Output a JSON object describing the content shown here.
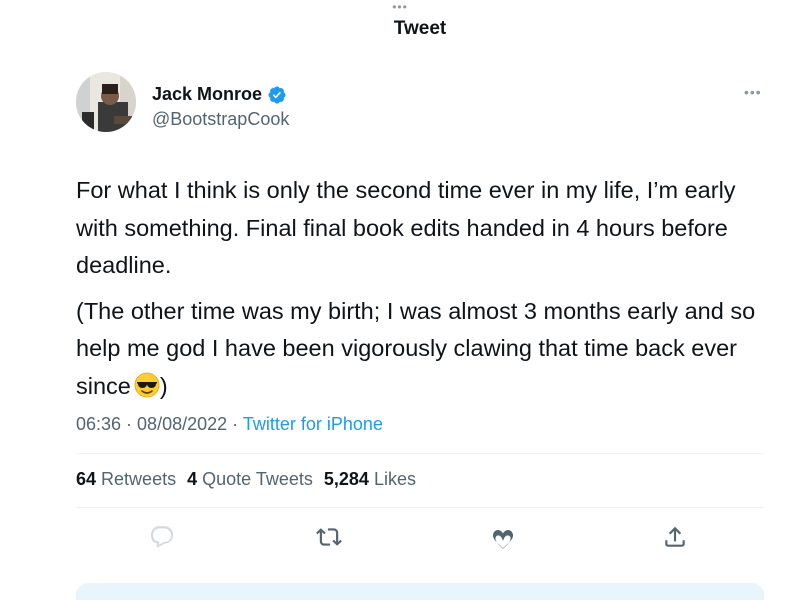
{
  "header": {
    "title": "Tweet",
    "dots": "•••"
  },
  "author": {
    "display_name": "Jack Monroe",
    "handle": "@BootstrapCook",
    "verified": true
  },
  "tweet": {
    "paragraphs": [
      "For what I think is only the second time ever in my life, I’m early with something. Final final book edits handed in 4 hours before deadline.",
      "(The other time was my birth; I was almost 3 months early and so help me god I have been vigorously clawing that time back ever since",
      ")"
    ],
    "emoji": "smiling-face-with-sunglasses"
  },
  "meta": {
    "time": "06:36",
    "separator1": " · ",
    "date": "08/08/2022",
    "separator2": " · ",
    "source": "Twitter for iPhone"
  },
  "stats": {
    "retweets_count": "64",
    "retweets_label": "Retweets",
    "quotes_count": "4",
    "quotes_label": "Quote Tweets",
    "likes_count": "5,284",
    "likes_label": "Likes"
  },
  "more_glyph": "•••",
  "colors": {
    "accent": "#1d9bf0",
    "text": "#0f1419",
    "secondary": "#536471"
  },
  "icons": [
    "reply-icon",
    "retweet-icon",
    "like-icon",
    "share-icon",
    "verified-badge-icon",
    "more-icon"
  ]
}
